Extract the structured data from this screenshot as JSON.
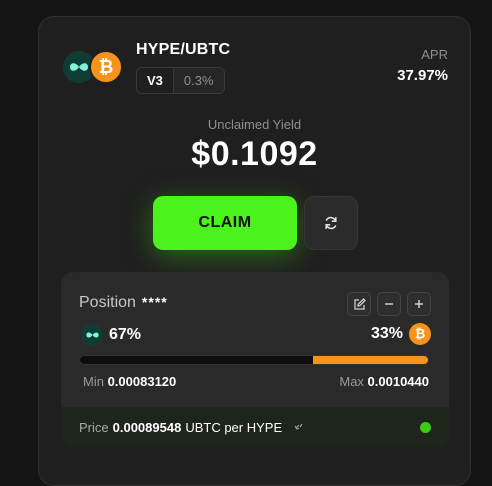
{
  "pool": {
    "pair": "HYPE/UBTC",
    "version": "V3",
    "fee": "0.3%",
    "apr_label": "APR",
    "apr_value": "37.97%"
  },
  "yield": {
    "label": "Unclaimed Yield",
    "value": "$0.1092"
  },
  "actions": {
    "claim_label": "CLAIM"
  },
  "position": {
    "title": "Position",
    "masked_id": "****",
    "token0_share": "67%",
    "token1_share": "33%",
    "range_fill_start": 0.67,
    "range_fill_end": 1.0,
    "min_label": "Min",
    "min_value": "0.00083120",
    "max_label": "Max",
    "max_value": "0.0010440"
  },
  "price": {
    "label": "Price",
    "value": "0.00089548",
    "unit": "UBTC per HYPE"
  },
  "colors": {
    "accent": "#4cf21c",
    "btc": "#f7931a",
    "hype": "#0f3d36",
    "status_dot": "#3ccb17"
  },
  "icons": [
    "hype-token-icon",
    "btc-token-icon",
    "refresh-icon",
    "edit-icon",
    "minus-icon",
    "plus-icon",
    "swap-arrows-icon"
  ]
}
